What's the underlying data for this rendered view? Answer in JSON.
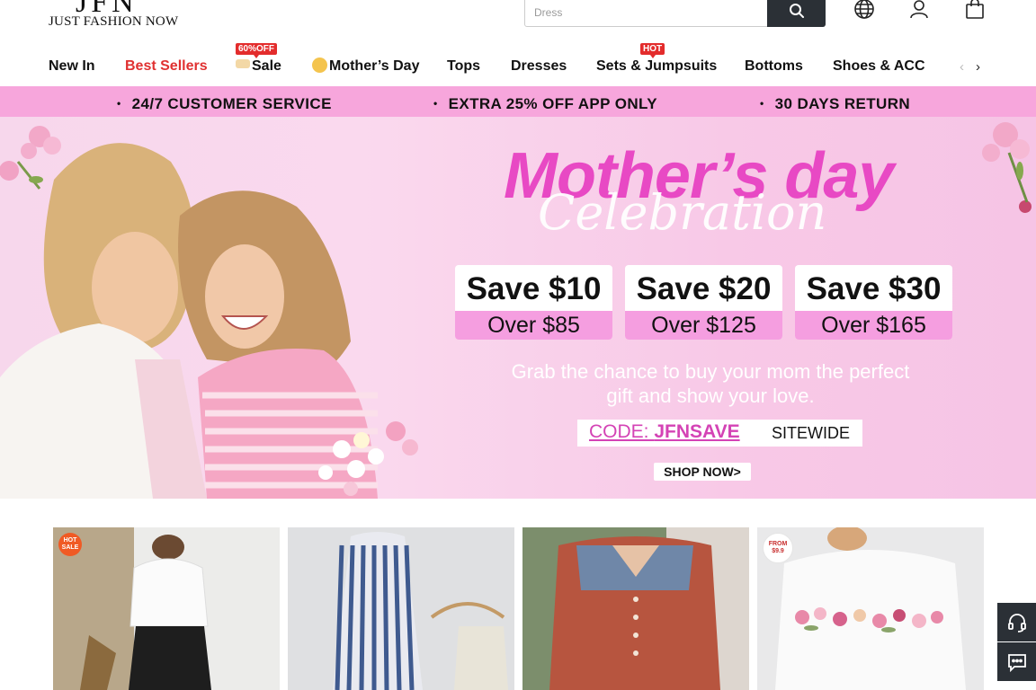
{
  "brand": {
    "logo_mark": "JFN",
    "logo_sub": "JUST FASHION NOW"
  },
  "search": {
    "placeholder": "Dress"
  },
  "header_icons": [
    "globe-icon",
    "user-icon",
    "bag-icon"
  ],
  "nav": {
    "items": [
      {
        "label": "New In"
      },
      {
        "label": "Best Sellers"
      },
      {
        "label": "Sale",
        "badge": "60%OFF"
      },
      {
        "label": "Mother’s Day"
      },
      {
        "label": "Tops"
      },
      {
        "label": "Dresses"
      },
      {
        "label": "Sets & Jumpsuits",
        "badge": "HOT"
      },
      {
        "label": "Bottoms"
      },
      {
        "label": "Shoes & ACC"
      }
    ],
    "prev_arrow": "‹",
    "next_arrow": "›"
  },
  "promo_strip": {
    "items": [
      "24/7 CUSTOMER SERVICE",
      "EXTRA 25% OFF APP ONLY",
      "30 DAYS RETURN"
    ]
  },
  "hero": {
    "title": "Mother’s day",
    "script": "Celebration",
    "coupons": [
      {
        "save": "Save $10",
        "over": "Over $85"
      },
      {
        "save": "Save $20",
        "over": "Over $125"
      },
      {
        "save": "Save $30",
        "over": "Over $165"
      }
    ],
    "tagline": "Grab the chance to buy your mom the perfect gift and show your love.",
    "code_label": "CODE: ",
    "code": "JFNSAVE",
    "code_scope": "SITEWIDE",
    "cta": "SHOP NOW>"
  },
  "products": [
    {
      "badge": "HOT SALE"
    },
    {
      "badge": ""
    },
    {
      "badge": ""
    },
    {
      "badge": "FROM $9.9"
    }
  ],
  "colors": {
    "accent_pink": "#e849c4",
    "strip_pink": "#f7a6dc",
    "hot_red": "#e32c2c",
    "dark": "#2b3036"
  }
}
